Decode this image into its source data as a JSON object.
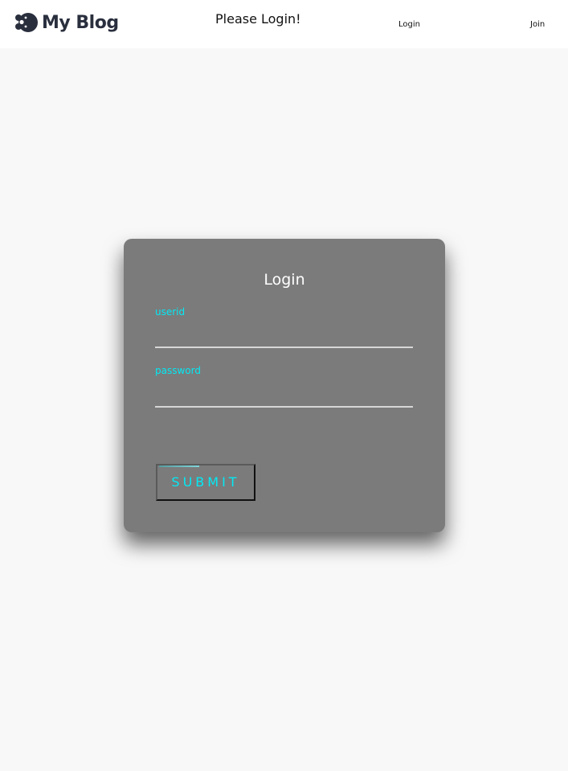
{
  "header": {
    "logo_text": "My Blog",
    "title": "Please Login!",
    "nav": {
      "login_label": "Login",
      "join_label": "Join"
    }
  },
  "login_form": {
    "title": "Login",
    "userid_label": "userid",
    "userid_value": "",
    "password_label": "password",
    "password_value": "",
    "submit_label": "SUBMIT"
  },
  "colors": {
    "background": "#f8f8f8",
    "card": "#7b7b7b",
    "accent": "#03e9f4",
    "logo": "#2a2f3e"
  },
  "icons": {
    "logo": "blog-logo-icon"
  }
}
